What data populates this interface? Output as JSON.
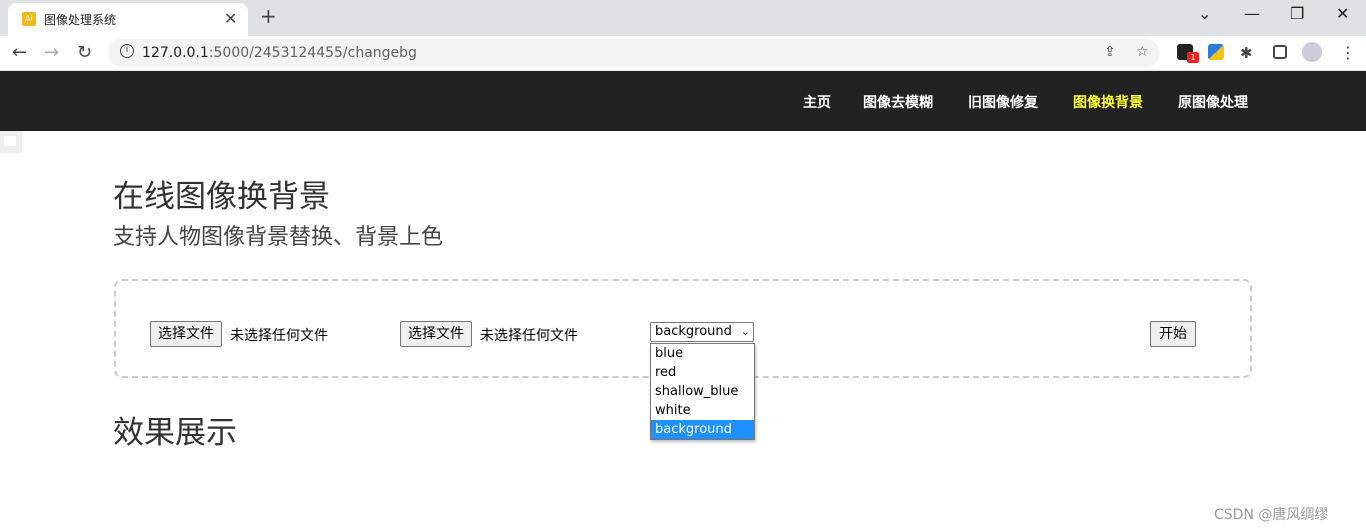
{
  "browser": {
    "tab_title": "图像处理系统",
    "tab_favicon": "Ai",
    "url_host": "127.0.0.1",
    "url_path": ":5000/2453124455/changebg",
    "ext_badge": "1"
  },
  "navbar": {
    "links": [
      "主页",
      "图像去模糊",
      "旧图像修复",
      "图像换背景",
      "原图像处理"
    ],
    "active_color": "#ffff33"
  },
  "page": {
    "title": "在线图像换背景",
    "subtitle": "支持人物图像背景替换、背景上色",
    "result_title": "效果展示"
  },
  "form": {
    "file_button_label": "选择文件",
    "file_status": "未选择任何文件",
    "select_value": "background",
    "options": [
      "blue",
      "red",
      "shallow_blue",
      "white",
      "background"
    ],
    "selected_option_color": "#1e90ff",
    "start_button": "开始"
  },
  "watermark": "CSDN @唐风绸缪"
}
